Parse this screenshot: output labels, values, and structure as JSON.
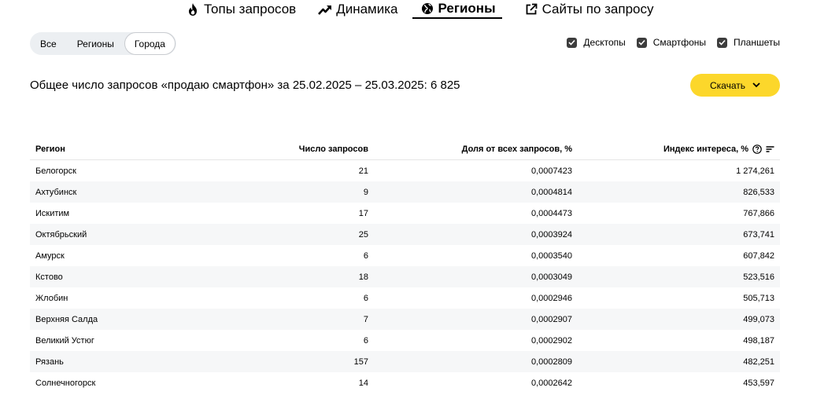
{
  "nav": {
    "tabs": [
      {
        "label": "Топы запросов",
        "icon": "fire-icon"
      },
      {
        "label": "Динамика",
        "icon": "trend-icon"
      },
      {
        "label": "Регионы",
        "icon": "globe-icon",
        "active": true
      },
      {
        "label": "Сайты по запросу",
        "icon": "external-link-icon"
      }
    ]
  },
  "segment": {
    "items": [
      "Все",
      "Регионы",
      "Города"
    ],
    "active": "Города"
  },
  "devices": [
    {
      "label": "Десктопы",
      "checked": true
    },
    {
      "label": "Смартфоны",
      "checked": true
    },
    {
      "label": "Планшеты",
      "checked": true
    }
  ],
  "summary": "Общее число запросов «продаю смартфон» за 25.02.2025 – 25.03.2025: 6 825",
  "download_label": "Скачать",
  "table": {
    "headers": [
      "Регион",
      "Число запросов",
      "Доля от всех запросов, %",
      "Индекс интереса, %"
    ],
    "rows": [
      [
        "Белогорск",
        "21",
        "0,0007423",
        "1 274,261"
      ],
      [
        "Ахтубинск",
        "9",
        "0,0004814",
        "826,533"
      ],
      [
        "Искитим",
        "17",
        "0,0004473",
        "767,866"
      ],
      [
        "Октябрьский",
        "25",
        "0,0003924",
        "673,741"
      ],
      [
        "Амурск",
        "6",
        "0,0003540",
        "607,842"
      ],
      [
        "Кстово",
        "18",
        "0,0003049",
        "523,516"
      ],
      [
        "Жлобин",
        "6",
        "0,0002946",
        "505,713"
      ],
      [
        "Верхняя Салда",
        "7",
        "0,0002907",
        "499,073"
      ],
      [
        "Великий Устюг",
        "6",
        "0,0002902",
        "498,187"
      ],
      [
        "Рязань",
        "157",
        "0,0002809",
        "482,251"
      ],
      [
        "Солнечногорск",
        "14",
        "0,0002642",
        "453,597"
      ]
    ]
  }
}
